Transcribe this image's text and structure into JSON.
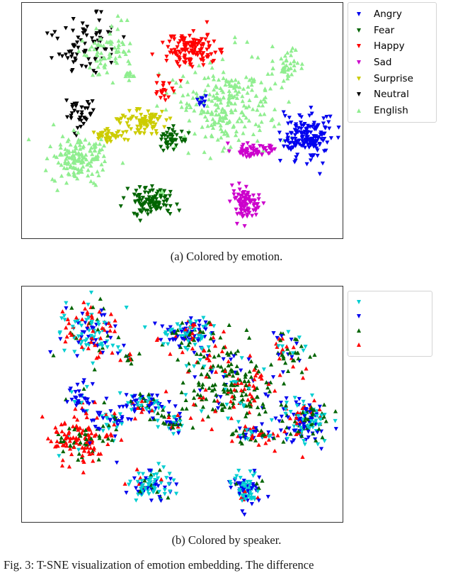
{
  "figure": {
    "caption": "Fig. 3: T-SNE visualization of emotion embedding. The difference"
  },
  "panels": [
    {
      "id": "a",
      "subcaption": "(a) Colored by emotion.",
      "legend": {
        "items": [
          {
            "label": "Angry",
            "color": "#0000ee",
            "marker": "triangle-down"
          },
          {
            "label": "Fear",
            "color": "#006400",
            "marker": "triangle-down"
          },
          {
            "label": "Happy",
            "color": "#ff0000",
            "marker": "triangle-down"
          },
          {
            "label": "Sad",
            "color": "#cc00cc",
            "marker": "triangle-down"
          },
          {
            "label": "Surprise",
            "color": "#cccc00",
            "marker": "triangle-down"
          },
          {
            "label": "Neutral",
            "color": "#000000",
            "marker": "triangle-down"
          },
          {
            "label": "English",
            "color": "#90ee90",
            "marker": "triangle-up"
          }
        ]
      }
    },
    {
      "id": "b",
      "subcaption": "(b) Colored by speaker.",
      "legend": {
        "items": [
          {
            "label": "",
            "color": "#00ced1",
            "marker": "triangle-down"
          },
          {
            "label": "",
            "color": "#0000ee",
            "marker": "triangle-down"
          },
          {
            "label": "",
            "color": "#006400",
            "marker": "triangle-up"
          },
          {
            "label": "",
            "color": "#ff0000",
            "marker": "triangle-up"
          }
        ]
      }
    }
  ],
  "chart_data": {
    "type": "scatter",
    "title": "T-SNE visualization of emotion embedding",
    "xlabel": "",
    "ylabel": "",
    "axes_visible": false,
    "grid": false,
    "tick_labels": [],
    "legend_position": "right",
    "panel_a": {
      "subtitle": "(a) Colored by emotion.",
      "color_by": "emotion",
      "series": [
        {
          "name": "Neutral",
          "color": "#000000",
          "marker": "triangle-down",
          "n": 115,
          "clusters": [
            {
              "cx": 0.205,
              "cy": 0.185,
              "rx": 0.105,
              "ry": 0.135,
              "n": 78
            },
            {
              "cx": 0.185,
              "cy": 0.47,
              "rx": 0.055,
              "ry": 0.065,
              "n": 35
            },
            {
              "cx": 0.165,
              "cy": 0.56,
              "rx": 0.01,
              "ry": 0.012,
              "n": 2
            }
          ]
        },
        {
          "name": "English",
          "color": "#90ee90",
          "marker": "triangle-up",
          "n": 520,
          "clusters": [
            {
              "cx": 0.265,
              "cy": 0.2,
              "rx": 0.085,
              "ry": 0.12,
              "n": 70
            },
            {
              "cx": 0.175,
              "cy": 0.65,
              "rx": 0.105,
              "ry": 0.105,
              "n": 145
            },
            {
              "cx": 0.64,
              "cy": 0.42,
              "rx": 0.175,
              "ry": 0.19,
              "n": 245
            },
            {
              "cx": 0.83,
              "cy": 0.27,
              "rx": 0.065,
              "ry": 0.075,
              "n": 40
            },
            {
              "cx": 0.335,
              "cy": 0.3,
              "rx": 0.025,
              "ry": 0.02,
              "n": 12
            },
            {
              "cx": 0.43,
              "cy": 0.81,
              "rx": 0.03,
              "ry": 0.035,
              "n": 8
            }
          ]
        },
        {
          "name": "Happy",
          "color": "#ff0000",
          "marker": "triangle-down",
          "n": 150,
          "clusters": [
            {
              "cx": 0.525,
              "cy": 0.2,
              "rx": 0.095,
              "ry": 0.08,
              "n": 130
            },
            {
              "cx": 0.45,
              "cy": 0.37,
              "rx": 0.045,
              "ry": 0.055,
              "n": 20
            }
          ]
        },
        {
          "name": "Surprise",
          "color": "#cccc00",
          "marker": "triangle-down",
          "n": 120,
          "clusters": [
            {
              "cx": 0.375,
              "cy": 0.5,
              "rx": 0.08,
              "ry": 0.055,
              "n": 80
            },
            {
              "cx": 0.275,
              "cy": 0.565,
              "rx": 0.06,
              "ry": 0.04,
              "n": 40
            }
          ]
        },
        {
          "name": "Fear",
          "color": "#006400",
          "marker": "triangle-down",
          "n": 140,
          "clusters": [
            {
              "cx": 0.47,
              "cy": 0.58,
              "rx": 0.05,
              "ry": 0.05,
              "n": 40
            },
            {
              "cx": 0.405,
              "cy": 0.845,
              "rx": 0.07,
              "ry": 0.065,
              "n": 100
            }
          ]
        },
        {
          "name": "Sad",
          "color": "#cc00cc",
          "marker": "triangle-down",
          "n": 145,
          "clusters": [
            {
              "cx": 0.725,
              "cy": 0.63,
              "rx": 0.075,
              "ry": 0.035,
              "n": 55
            },
            {
              "cx": 0.7,
              "cy": 0.855,
              "rx": 0.045,
              "ry": 0.08,
              "n": 90
            }
          ]
        },
        {
          "name": "Angry",
          "color": "#0000ee",
          "marker": "triangle-down",
          "n": 175,
          "clusters": [
            {
              "cx": 0.885,
              "cy": 0.57,
              "rx": 0.085,
              "ry": 0.105,
              "n": 165
            },
            {
              "cx": 0.56,
              "cy": 0.42,
              "rx": 0.02,
              "ry": 0.025,
              "n": 10
            }
          ]
        }
      ]
    },
    "panel_b": {
      "subtitle": "(b) Colored by speaker.",
      "color_by": "speaker",
      "note": "Same point positions as panel (a); speaker colors are intermixed within every emotion cluster.",
      "speaker_colors": [
        "#00ced1",
        "#0000ee",
        "#006400",
        "#ff0000"
      ],
      "regions": [
        {
          "name": "top-left",
          "cx": 0.215,
          "cy": 0.195,
          "rx": 0.11,
          "ry": 0.14,
          "n": 150,
          "mix": [
            0.33,
            0.27,
            0.1,
            0.3
          ]
        },
        {
          "name": "left-mid",
          "cx": 0.185,
          "cy": 0.47,
          "rx": 0.055,
          "ry": 0.07,
          "n": 40,
          "mix": [
            0.2,
            0.72,
            0.04,
            0.04
          ]
        },
        {
          "name": "left-lower",
          "cx": 0.175,
          "cy": 0.65,
          "rx": 0.105,
          "ry": 0.105,
          "n": 150,
          "mix": [
            0.02,
            0.03,
            0.2,
            0.75
          ]
        },
        {
          "name": "center-top",
          "cx": 0.52,
          "cy": 0.205,
          "rx": 0.1,
          "ry": 0.085,
          "n": 135,
          "mix": [
            0.34,
            0.34,
            0.12,
            0.2
          ]
        },
        {
          "name": "center-mass",
          "cx": 0.645,
          "cy": 0.42,
          "rx": 0.18,
          "ry": 0.195,
          "n": 255,
          "mix": [
            0.08,
            0.1,
            0.55,
            0.27
          ]
        },
        {
          "name": "center-left-mid",
          "cx": 0.375,
          "cy": 0.5,
          "rx": 0.085,
          "ry": 0.06,
          "n": 85,
          "mix": [
            0.3,
            0.42,
            0.18,
            0.1
          ]
        },
        {
          "name": "lower-left-arc",
          "cx": 0.275,
          "cy": 0.57,
          "rx": 0.06,
          "ry": 0.045,
          "n": 45,
          "mix": [
            0.35,
            0.4,
            0.15,
            0.1
          ]
        },
        {
          "name": "right-cluster",
          "cx": 0.885,
          "cy": 0.57,
          "rx": 0.085,
          "ry": 0.105,
          "n": 170,
          "mix": [
            0.3,
            0.34,
            0.24,
            0.12
          ]
        },
        {
          "name": "bottom-left",
          "cx": 0.405,
          "cy": 0.845,
          "rx": 0.072,
          "ry": 0.067,
          "n": 105,
          "mix": [
            0.52,
            0.33,
            0.07,
            0.08
          ]
        },
        {
          "name": "bottom-right",
          "cx": 0.7,
          "cy": 0.855,
          "rx": 0.047,
          "ry": 0.082,
          "n": 95,
          "mix": [
            0.5,
            0.36,
            0.08,
            0.06
          ]
        },
        {
          "name": "sad-arc",
          "cx": 0.725,
          "cy": 0.63,
          "rx": 0.078,
          "ry": 0.038,
          "n": 60,
          "mix": [
            0.18,
            0.22,
            0.38,
            0.22
          ]
        },
        {
          "name": "fear-upper",
          "cx": 0.47,
          "cy": 0.58,
          "rx": 0.052,
          "ry": 0.052,
          "n": 45,
          "mix": [
            0.22,
            0.26,
            0.36,
            0.16
          ]
        },
        {
          "name": "islet",
          "cx": 0.335,
          "cy": 0.3,
          "rx": 0.028,
          "ry": 0.02,
          "n": 14,
          "mix": [
            0.05,
            0.05,
            0.45,
            0.45
          ]
        },
        {
          "name": "far-right-top",
          "cx": 0.83,
          "cy": 0.27,
          "rx": 0.068,
          "ry": 0.078,
          "n": 45,
          "mix": [
            0.22,
            0.26,
            0.34,
            0.18
          ]
        }
      ]
    }
  }
}
